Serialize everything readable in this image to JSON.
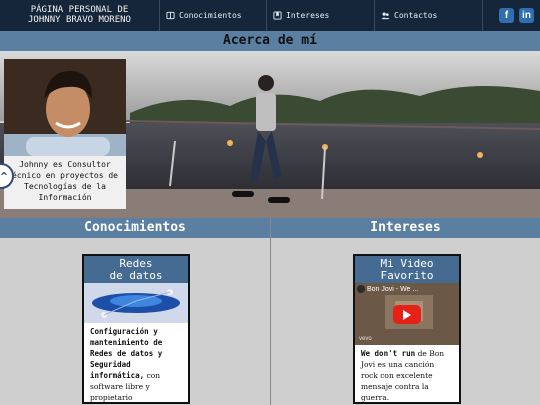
{
  "header": {
    "brand_line1": "PÁGINA PERSONAL DE",
    "brand_line2": "JOHNNY BRAVO MORENO",
    "nav": [
      {
        "label": "Conocimientos",
        "icon": "book-icon"
      },
      {
        "label": "Intereses",
        "icon": "bookmark-icon"
      },
      {
        "label": "Contactos",
        "icon": "users-icon"
      }
    ],
    "social": [
      {
        "label": "f",
        "icon": "facebook-icon"
      },
      {
        "label": "in",
        "icon": "linkedin-icon"
      }
    ]
  },
  "about": {
    "title": "Acerca de mí",
    "caption": "Johnny es Consultor\nécnico en proyectos de\nTecnologías de la\nInformación"
  },
  "knowledge": {
    "title": "Conocimientos",
    "card_title": "Redes\nde datos",
    "card_text_bold": "Configuración y mantenimiento de Redes de datos y Seguridad informática,",
    "card_text_rest": " con software libre y propietario"
  },
  "interests": {
    "title": "Intereses",
    "card_title": "Mi Video\nFavorito",
    "video_title": "Bon Jovi - We ...",
    "video_brand": "vevo",
    "card_text_bold": "We don't run",
    "card_text_rest": " de Bon Jovi es una canción rock con excelente mensaje contra la guerra."
  },
  "colors": {
    "nav_bg": "#16263a",
    "section_bar": "#5b7fa0",
    "card_title_bg": "#466b92",
    "page_bg": "#cfcfcf"
  }
}
